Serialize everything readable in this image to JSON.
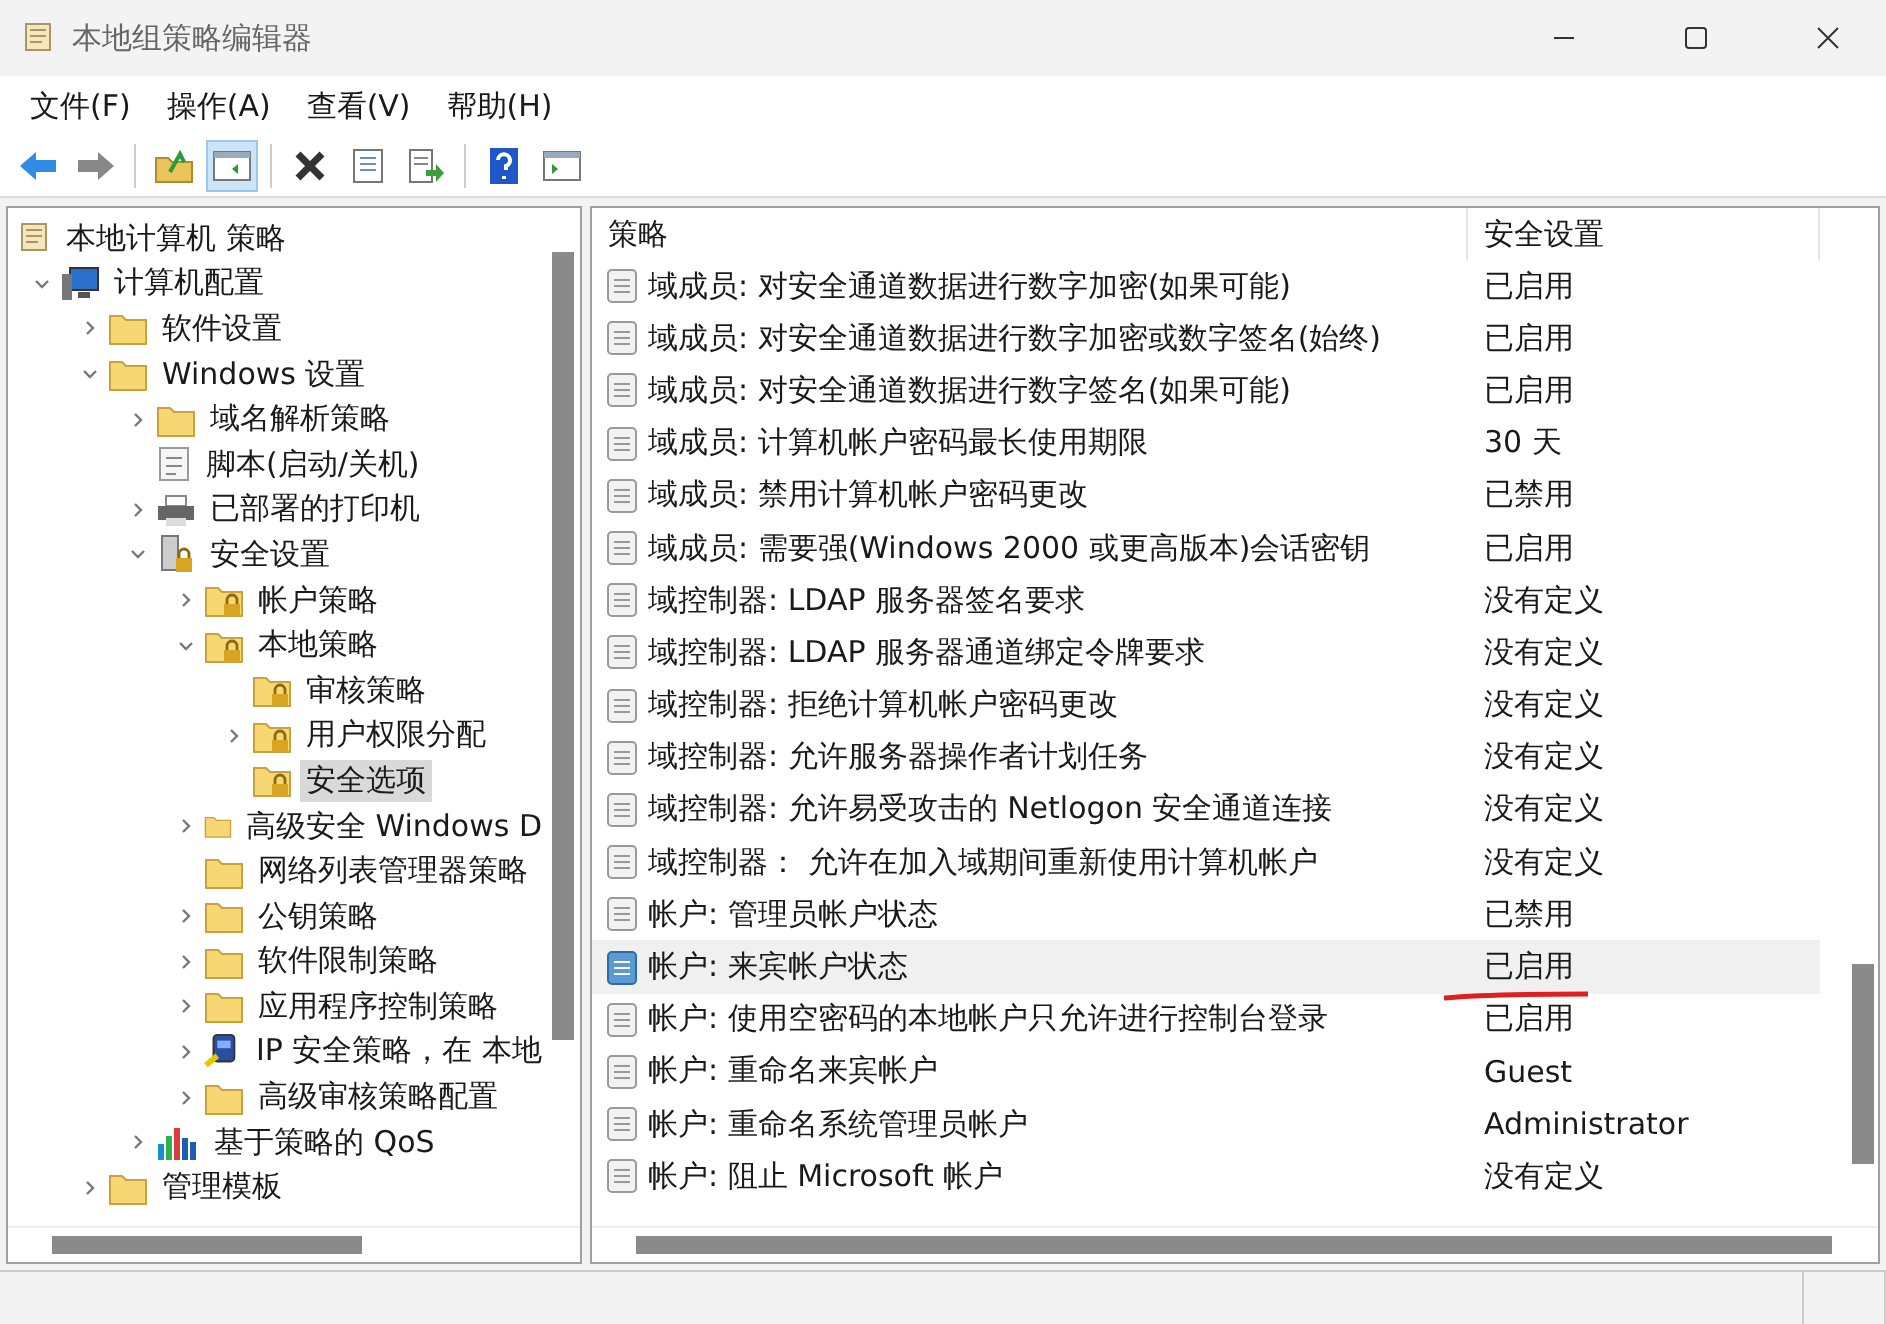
{
  "window": {
    "title": "本地组策略编辑器"
  },
  "menu": [
    "文件(F)",
    "操作(A)",
    "查看(V)",
    "帮助(H)"
  ],
  "toolbar": [
    {
      "kind": "back",
      "pressed": false
    },
    {
      "kind": "forward",
      "pressed": false
    },
    {
      "kind": "sep"
    },
    {
      "kind": "up",
      "pressed": false
    },
    {
      "kind": "tree",
      "pressed": true
    },
    {
      "kind": "sep"
    },
    {
      "kind": "delete",
      "pressed": false
    },
    {
      "kind": "properties",
      "pressed": false
    },
    {
      "kind": "export",
      "pressed": false
    },
    {
      "kind": "sep"
    },
    {
      "kind": "help",
      "pressed": false
    },
    {
      "kind": "console",
      "pressed": false
    }
  ],
  "tree": [
    {
      "label": "本地计算机 策略",
      "kind": "doc",
      "selected": false,
      "children": [
        {
          "label": "计算机配置",
          "kind": "computer",
          "expanded": true,
          "selected": false,
          "children": [
            {
              "label": "软件设置",
              "kind": "folder",
              "expanded": false,
              "selected": false
            },
            {
              "label": "Windows 设置",
              "kind": "folder",
              "expanded": true,
              "selected": false,
              "children": [
                {
                  "label": "域名解析策略",
                  "kind": "folder",
                  "expanded": false,
                  "selected": false
                },
                {
                  "label": "脚本(启动/关机)",
                  "kind": "script",
                  "selected": false
                },
                {
                  "label": "已部署的打印机",
                  "kind": "printer",
                  "expanded": false,
                  "selected": false
                },
                {
                  "label": "安全设置",
                  "kind": "server",
                  "expanded": true,
                  "selected": false,
                  "children": [
                    {
                      "label": "帐户策略",
                      "kind": "lockfolder",
                      "expanded": false,
                      "selected": false
                    },
                    {
                      "label": "本地策略",
                      "kind": "lockfolder",
                      "expanded": true,
                      "selected": false,
                      "children": [
                        {
                          "label": "审核策略",
                          "kind": "lockfolder",
                          "selected": false
                        },
                        {
                          "label": "用户权限分配",
                          "kind": "lockfolder",
                          "expanded": false,
                          "selected": false
                        },
                        {
                          "label": "安全选项",
                          "kind": "lockfolder",
                          "selected": true
                        }
                      ]
                    },
                    {
                      "label": "高级安全 Windows D",
                      "kind": "folder",
                      "expanded": false,
                      "selected": false
                    },
                    {
                      "label": "网络列表管理器策略",
                      "kind": "folder",
                      "selected": false
                    },
                    {
                      "label": "公钥策略",
                      "kind": "folder",
                      "expanded": false,
                      "selected": false
                    },
                    {
                      "label": "软件限制策略",
                      "kind": "folder",
                      "expanded": false,
                      "selected": false
                    },
                    {
                      "label": "应用程序控制策略",
                      "kind": "folder",
                      "expanded": false,
                      "selected": false
                    },
                    {
                      "label": "IP 安全策略，在 本地",
                      "kind": "ipsec",
                      "expanded": false,
                      "selected": false
                    },
                    {
                      "label": "高级审核策略配置",
                      "kind": "folder",
                      "expanded": false,
                      "selected": false
                    }
                  ]
                },
                {
                  "label": "基于策略的 QoS",
                  "kind": "chart",
                  "expanded": false,
                  "selected": false
                }
              ]
            },
            {
              "label": "管理模板",
              "kind": "folder",
              "expanded": false,
              "selected": false
            }
          ]
        }
      ]
    }
  ],
  "table": {
    "columns": [
      "策略",
      "安全设置"
    ],
    "rows": [
      {
        "policy": "域成员: 对安全通道数据进行数字加密(如果可能)",
        "setting": "已启用",
        "selected": false,
        "marked": false
      },
      {
        "policy": "域成员: 对安全通道数据进行数字加密或数字签名(始终)",
        "setting": "已启用",
        "selected": false,
        "marked": false
      },
      {
        "policy": "域成员: 对安全通道数据进行数字签名(如果可能)",
        "setting": "已启用",
        "selected": false,
        "marked": false
      },
      {
        "policy": "域成员: 计算机帐户密码最长使用期限",
        "setting": "30 天",
        "selected": false,
        "marked": false
      },
      {
        "policy": "域成员: 禁用计算机帐户密码更改",
        "setting": "已禁用",
        "selected": false,
        "marked": false
      },
      {
        "policy": "域成员: 需要强(Windows 2000 或更高版本)会话密钥",
        "setting": "已启用",
        "selected": false,
        "marked": false
      },
      {
        "policy": "域控制器: LDAP 服务器签名要求",
        "setting": "没有定义",
        "selected": false,
        "marked": false
      },
      {
        "policy": "域控制器: LDAP 服务器通道绑定令牌要求",
        "setting": "没有定义",
        "selected": false,
        "marked": false
      },
      {
        "policy": "域控制器: 拒绝计算机帐户密码更改",
        "setting": "没有定义",
        "selected": false,
        "marked": false
      },
      {
        "policy": "域控制器: 允许服务器操作者计划任务",
        "setting": "没有定义",
        "selected": false,
        "marked": false
      },
      {
        "policy": "域控制器: 允许易受攻击的 Netlogon 安全通道连接",
        "setting": "没有定义",
        "selected": false,
        "marked": false
      },
      {
        "policy": "域控制器：  允许在加入域期间重新使用计算机帐户",
        "setting": "没有定义",
        "selected": false,
        "marked": false
      },
      {
        "policy": "帐户: 管理员帐户状态",
        "setting": "已禁用",
        "selected": false,
        "marked": false
      },
      {
        "policy": "帐户: 来宾帐户状态",
        "setting": "已启用",
        "selected": true,
        "marked": true
      },
      {
        "policy": "帐户: 使用空密码的本地帐户只允许进行控制台登录",
        "setting": "已启用",
        "selected": false,
        "marked": false
      },
      {
        "policy": "帐户: 重命名来宾帐户",
        "setting": "Guest",
        "selected": false,
        "marked": false
      },
      {
        "policy": "帐户: 重命名系统管理员帐户",
        "setting": "Administrator",
        "selected": false,
        "marked": false
      },
      {
        "policy": "帐户: 阻止 Microsoft 帐户",
        "setting": "没有定义",
        "selected": false,
        "marked": false
      }
    ]
  }
}
